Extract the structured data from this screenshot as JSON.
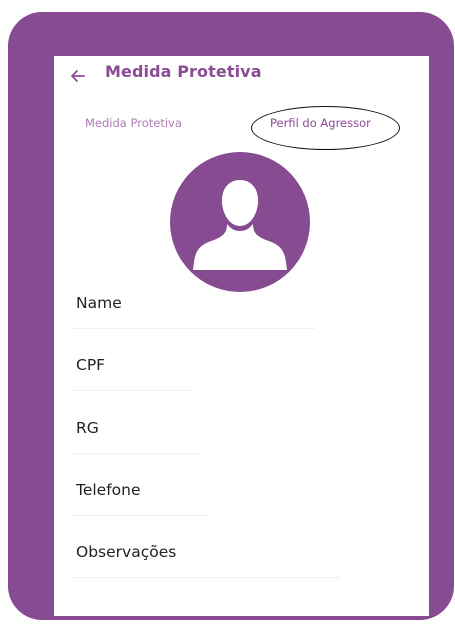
{
  "header": {
    "title": "Medida Protetiva",
    "back_icon": "arrow-left-icon"
  },
  "tabs": [
    {
      "label": "Medida Protetiva",
      "selected": false
    },
    {
      "label": "Perfil do Agressor",
      "selected": true
    }
  ],
  "avatar": {
    "icon": "user-silhouette-icon",
    "color": "#874b91"
  },
  "form": {
    "fields": [
      {
        "label": "Name",
        "value": ""
      },
      {
        "label": "CPF",
        "value": ""
      },
      {
        "label": "RG",
        "value": ""
      },
      {
        "label": "Telefone",
        "value": ""
      },
      {
        "label": "Observações",
        "value": ""
      }
    ]
  },
  "colors": {
    "frame": "#874b91",
    "accent": "#8b4c95",
    "tab_inactive": "#b07ab8",
    "text": "#222222"
  }
}
